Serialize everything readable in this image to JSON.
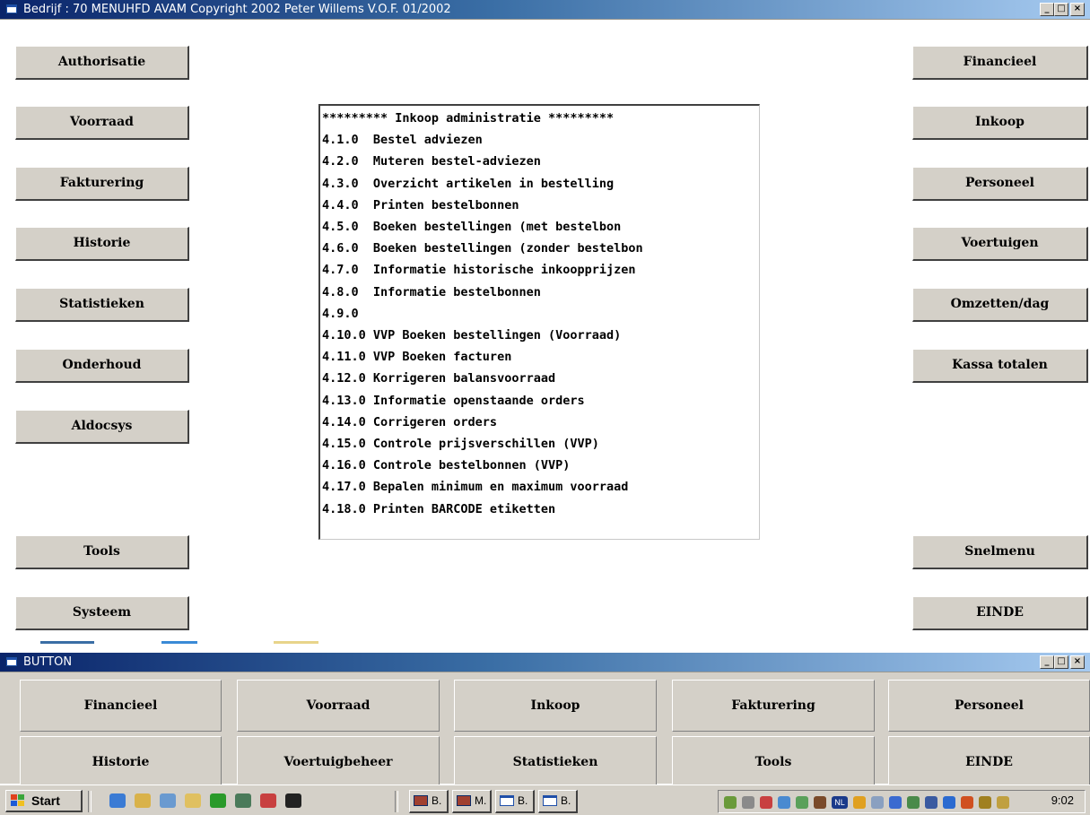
{
  "main_window": {
    "title": "Bedrijf : 70 MENUHFD   AVAM Copyright 2002 Peter Willems V.O.F.      01/2002",
    "minimize": "_",
    "maximize": "□",
    "close": "×",
    "left_buttons": [
      "Authorisatie",
      "Voorraad",
      "Fakturering",
      "Historie",
      "Statistieken",
      "Onderhoud",
      "Aldocsys",
      "Tools",
      "Systeem"
    ],
    "right_buttons": [
      "Financieel",
      "Inkoop",
      "Personeel",
      "Voertuigen",
      "Omzetten/dag",
      "Kassa totalen",
      "Snelmenu",
      "EINDE"
    ],
    "menu_lines": [
      "********* Inkoop administratie *********",
      "4.1.0  Bestel adviezen",
      "4.2.0  Muteren bestel-adviezen",
      "4.3.0  Overzicht artikelen in bestelling",
      "4.4.0  Printen bestelbonnen",
      "4.5.0  Boeken bestellingen (met bestelbon",
      "4.6.0  Boeken bestellingen (zonder bestelbon",
      "4.7.0  Informatie historische inkoopprijzen",
      "4.8.0  Informatie bestelbonnen",
      "4.9.0",
      "4.10.0 VVP Boeken bestellingen (Voorraad)",
      "4.11.0 VVP Boeken facturen",
      "4.12.0 Korrigeren balansvoorraad",
      "4.13.0 Informatie openstaande orders",
      "4.14.0 Corrigeren orders",
      "4.15.0 Controle prijsverschillen (VVP)",
      "4.16.0 Controle bestelbonnen (VVP)",
      "4.17.0 Bepalen minimum en maximum voorraad",
      "4.18.0 Printen BARCODE etiketten"
    ]
  },
  "button_window": {
    "title": "BUTTON",
    "minimize": "_",
    "maximize": "□",
    "close": "×",
    "row1": [
      "Financieel",
      "Voorraad",
      "Inkoop",
      "Fakturering",
      "Personeel"
    ],
    "row2": [
      "Historie",
      "Voertuigbeheer",
      "Statistieken",
      "Tools",
      "EINDE"
    ]
  },
  "taskbar": {
    "start_label": "Start",
    "task_buttons": [
      "B.",
      "M.",
      "B.",
      "B."
    ],
    "clock": "9:02",
    "tray_label": "NL"
  },
  "colors": {
    "title_gradient_start": "#0a246a",
    "title_gradient_end": "#a6caf0",
    "face": "#d4d0c8"
  }
}
